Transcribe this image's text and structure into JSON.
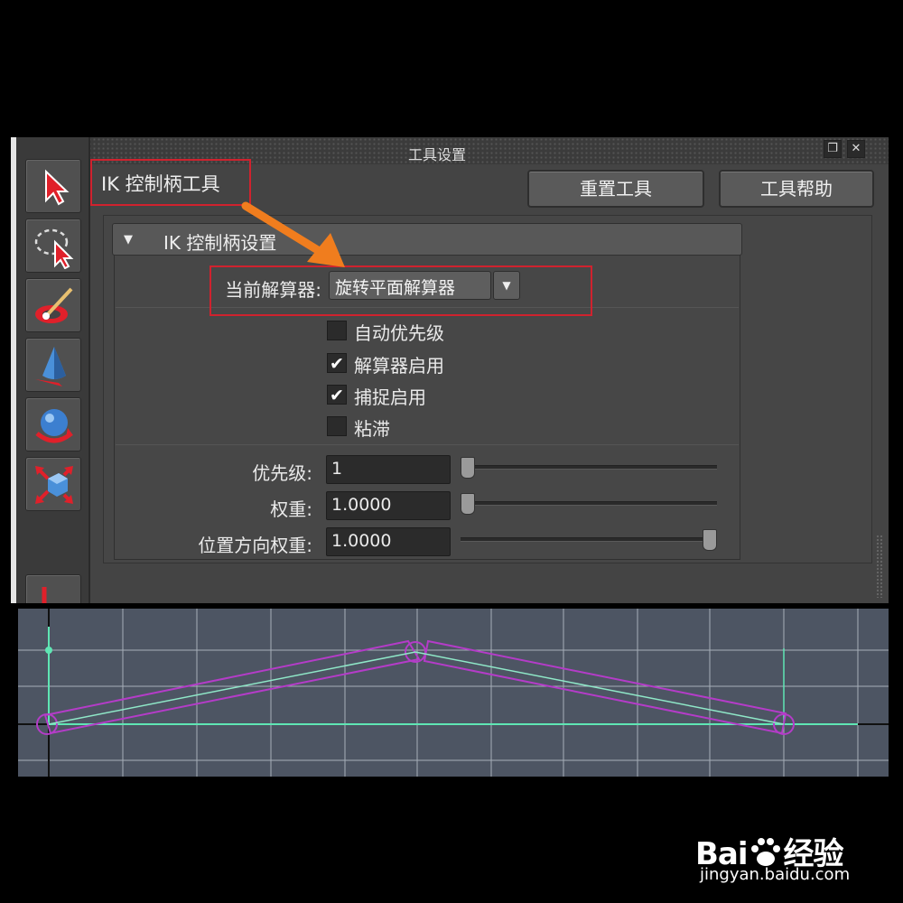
{
  "window": {
    "title": "工具设置",
    "restore_glyph": "❐",
    "close_glyph": "✕"
  },
  "toolbar": {
    "items": [
      {
        "icon": "select-arrow-icon"
      },
      {
        "icon": "lasso-select-icon"
      },
      {
        "icon": "paint-select-icon"
      },
      {
        "icon": "move-cone-icon"
      },
      {
        "icon": "rotate-sphere-icon"
      },
      {
        "icon": "scale-cube-icon"
      },
      {
        "icon": "ik-handle-icon"
      }
    ]
  },
  "header": {
    "tool_name": "IK 控制柄工具",
    "reset_label": "重置工具",
    "help_label": "工具帮助"
  },
  "section": {
    "title": "IK 控制柄设置",
    "collapse_glyph": "▼",
    "solver_label": "当前解算器:",
    "solver_value": "旋转平面解算器",
    "solver_dropdown_glyph": "▼",
    "checkboxes": [
      {
        "label": "自动优先级",
        "checked": false,
        "mark": ""
      },
      {
        "label": "解算器启用",
        "checked": true,
        "mark": "✔"
      },
      {
        "label": "捕捉启用",
        "checked": true,
        "mark": "✔"
      },
      {
        "label": "粘滞",
        "checked": false,
        "mark": ""
      }
    ],
    "sliders": [
      {
        "label": "优先级:",
        "value": "1",
        "fraction": 0.0
      },
      {
        "label": "权重:",
        "value": "1.0000",
        "fraction": 0.0
      },
      {
        "label": "位置方向权重:",
        "value": "1.0000",
        "fraction": 1.0
      }
    ]
  },
  "colors": {
    "annotation_red": "#d0222e",
    "arrow_orange": "#f07d1e",
    "bone_green": "#5fe6b4",
    "handle_magenta": "#b43cc8",
    "viewport_bg": "#4d5563"
  },
  "watermark": {
    "brand": "Bai",
    "brand_suffix": "经验",
    "url": "jingyan.baidu.com"
  }
}
